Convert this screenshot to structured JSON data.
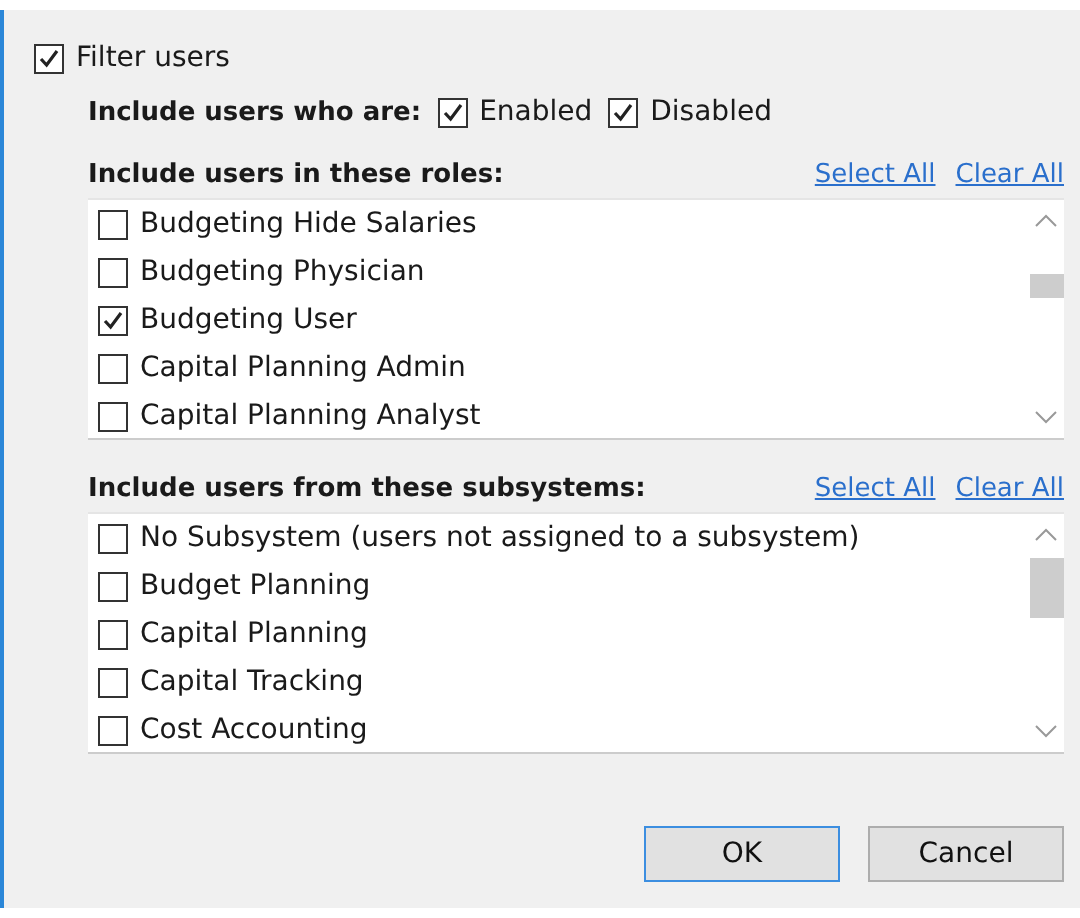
{
  "filter_users": {
    "label": "Filter users",
    "checked": true
  },
  "status_filter": {
    "label": "Include users who are:",
    "options": [
      {
        "label": "Enabled",
        "checked": true
      },
      {
        "label": "Disabled",
        "checked": true
      }
    ]
  },
  "roles": {
    "label": "Include users in these roles:",
    "select_all": "Select All",
    "clear_all": "Clear All",
    "items": [
      {
        "label": "Budgeting Hide Salaries",
        "checked": false
      },
      {
        "label": "Budgeting Physician",
        "checked": false
      },
      {
        "label": "Budgeting User",
        "checked": true
      },
      {
        "label": "Capital Planning Admin",
        "checked": false
      },
      {
        "label": "Capital Planning Analyst",
        "checked": false
      }
    ]
  },
  "subsystems": {
    "label": "Include users from these subsystems:",
    "select_all": "Select All",
    "clear_all": "Clear All",
    "items": [
      {
        "label": "No Subsystem (users not assigned to a subsystem)",
        "checked": false
      },
      {
        "label": "Budget Planning",
        "checked": false
      },
      {
        "label": "Capital Planning",
        "checked": false
      },
      {
        "label": "Capital Tracking",
        "checked": false
      },
      {
        "label": "Cost Accounting",
        "checked": false
      }
    ]
  },
  "buttons": [
    {
      "label": "OK",
      "default": true
    },
    {
      "label": "Cancel",
      "default": false
    }
  ]
}
